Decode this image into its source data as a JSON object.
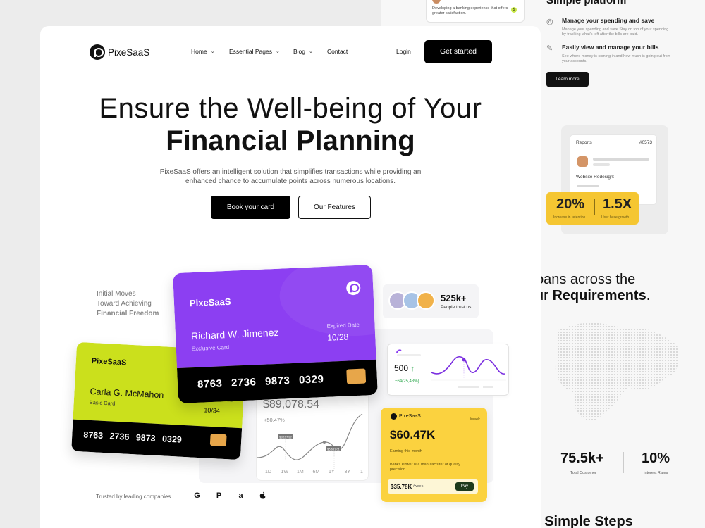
{
  "background_page": {
    "top_card": {
      "text": "Developing a banking experience that offers greater satisfaction.",
      "badge": "5"
    },
    "simple_platform": {
      "title": "Simple platform",
      "features": [
        {
          "heading": "Manage your spending and save",
          "desc": "Manage your spending and save Stay on top of your spending by tracking what's left after the bills are paid.",
          "icon": "wallet-icon"
        },
        {
          "heading": "Easily view and manage your bills",
          "desc": "See where money is coming in and how much is going out from your accounts.",
          "icon": "bill-icon"
        }
      ],
      "learn_more": "Learn more"
    },
    "reports": {
      "title": "Reports",
      "number": "#0573",
      "subtitle": "Website Redesign:",
      "stats": [
        {
          "value": "20%",
          "label": "Increase in retention"
        },
        {
          "value": "1.5X",
          "label": "User base growth"
        }
      ]
    },
    "spans": {
      "line1": "pans across the",
      "line2_prefix": "ur ",
      "line2_bold": "Requirements",
      "line2_suffix": "."
    },
    "bottom_stats": [
      {
        "value": "75.5k+",
        "label": "Total Customer"
      },
      {
        "value": "10%",
        "label": "Interest Rates"
      }
    ],
    "steps": {
      "prefix": "r ",
      "bold": "Simple Steps"
    }
  },
  "header": {
    "brand": "PixeSaaS",
    "nav": [
      {
        "label": "Home",
        "dropdown": true
      },
      {
        "label": "Essential Pages",
        "dropdown": true
      },
      {
        "label": "Blog",
        "dropdown": true
      },
      {
        "label": "Contact",
        "dropdown": false
      }
    ],
    "login": "Login",
    "cta": "Get started"
  },
  "hero": {
    "line1": "Ensure the Well-being of Your",
    "line2": "Financial Planning",
    "subtitle": "PixeSaaS offers an intelligent solution that simplifies transactions while providing an enhanced chance to accumulate points across numerous locations.",
    "primary_button": "Book your card",
    "secondary_button": "Our Features"
  },
  "tagline": {
    "line1": "Initial Moves",
    "line2": "Toward Achieving",
    "line3": "Financial Freedom"
  },
  "purple_card": {
    "brand": "PixeSaaS",
    "holder": "Richard W. Jimenez",
    "type": "Exclusive Card",
    "expiry_label": "Expired Date",
    "expiry": "10/28",
    "number": "8763 2736 9873 0329"
  },
  "lime_card": {
    "brand": "PixeSaaS",
    "holder": "Carla G. McMahon",
    "type": "Basic Card",
    "expiry_label": "Expired Date",
    "expiry": "10/34",
    "number": "8763 2736 9873 0329"
  },
  "balance": {
    "amount": "$89,078.54",
    "change": "+50,47%",
    "tooltips": [
      "$3,117.92",
      "$6,681.01"
    ],
    "tabs": [
      "1D",
      "1W",
      "1M",
      "6M",
      "1Y",
      "3Y",
      "1"
    ]
  },
  "people": {
    "value": "525k+",
    "label": "People trust us"
  },
  "mini_chart": {
    "value": "500",
    "arrow": "↑",
    "change": "+64(25,48%)"
  },
  "earnings": {
    "brand": "PixeSaaS",
    "period": "/week",
    "value": "$60.47K",
    "label": "Earning this month",
    "desc": "Banks Power is a manufacturer of quality precision",
    "weekly_value": "$35.78K",
    "weekly_unit": "/week",
    "pay_button": "Pay"
  },
  "trusted": {
    "label": "Trusted by leading companies",
    "logos": [
      {
        "icon": "google-icon",
        "glyph": "G"
      },
      {
        "icon": "paypal-icon",
        "glyph": "P"
      },
      {
        "icon": "amazon-icon",
        "glyph": "a"
      },
      {
        "icon": "apple-icon",
        "glyph": ""
      }
    ]
  },
  "colors": {
    "purple": "#8c3ff2",
    "lime": "#cbe01c",
    "yellow": "#fbd23f",
    "black": "#000000"
  }
}
